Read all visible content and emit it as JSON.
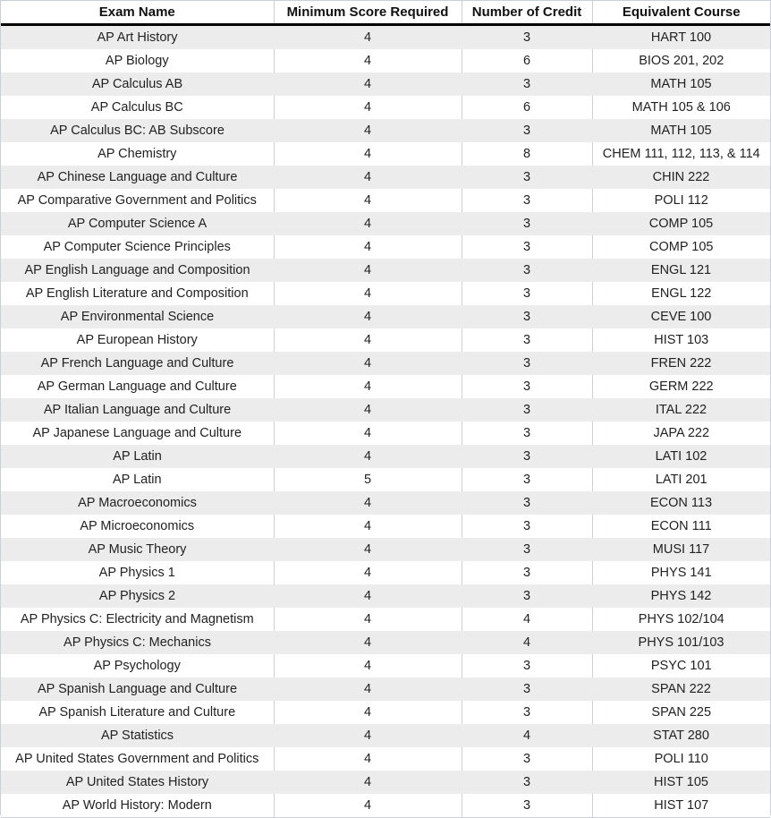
{
  "table": {
    "headers": [
      "Exam Name",
      "Minimum Score Required",
      "Number of Credit",
      "Equivalent Course"
    ],
    "rows": [
      [
        "AP Art History",
        "4",
        "3",
        "HART 100"
      ],
      [
        "AP Biology",
        "4",
        "6",
        "BIOS 201, 202"
      ],
      [
        "AP Calculus AB",
        "4",
        "3",
        "MATH 105"
      ],
      [
        "AP Calculus BC",
        "4",
        "6",
        "MATH 105 & 106"
      ],
      [
        "AP Calculus BC: AB Subscore",
        "4",
        "3",
        "MATH 105"
      ],
      [
        "AP Chemistry",
        "4",
        "8",
        "CHEM 111, 112, 113, & 114"
      ],
      [
        "AP Chinese Language and Culture",
        "4",
        "3",
        "CHIN 222"
      ],
      [
        "AP Comparative Government and Politics",
        "4",
        "3",
        "POLI 112"
      ],
      [
        "AP Computer Science A",
        "4",
        "3",
        "COMP 105"
      ],
      [
        "AP Computer Science Principles",
        "4",
        "3",
        "COMP 105"
      ],
      [
        "AP English Language and Composition",
        "4",
        "3",
        "ENGL 121"
      ],
      [
        "AP English Literature and Composition",
        "4",
        "3",
        "ENGL 122"
      ],
      [
        "AP Environmental Science",
        "4",
        "3",
        "CEVE 100"
      ],
      [
        "AP European History",
        "4",
        "3",
        "HIST 103"
      ],
      [
        "AP French Language and Culture",
        "4",
        "3",
        "FREN 222"
      ],
      [
        "AP German Language and Culture",
        "4",
        "3",
        "GERM 222"
      ],
      [
        "AP Italian Language and Culture",
        "4",
        "3",
        "ITAL 222"
      ],
      [
        "AP Japanese Language and Culture",
        "4",
        "3",
        "JAPA 222"
      ],
      [
        "AP Latin",
        "4",
        "3",
        "LATI 102"
      ],
      [
        "AP Latin",
        "5",
        "3",
        "LATI 201"
      ],
      [
        "AP Macroeconomics",
        "4",
        "3",
        "ECON 113"
      ],
      [
        "AP Microeconomics",
        "4",
        "3",
        "ECON 111"
      ],
      [
        "AP Music Theory",
        "4",
        "3",
        "MUSI 117"
      ],
      [
        "AP Physics 1",
        "4",
        "3",
        "PHYS 141"
      ],
      [
        "AP Physics 2",
        "4",
        "3",
        "PHYS 142"
      ],
      [
        "AP Physics C: Electricity and Magnetism",
        "4",
        "4",
        "PHYS 102/104"
      ],
      [
        "AP Physics C: Mechanics",
        "4",
        "4",
        "PHYS 101/103"
      ],
      [
        "AP Psychology",
        "4",
        "3",
        "PSYC 101"
      ],
      [
        "AP Spanish Language and Culture",
        "4",
        "3",
        "SPAN 222"
      ],
      [
        "AP Spanish Literature and Culture",
        "4",
        "3",
        "SPAN 225"
      ],
      [
        "AP Statistics",
        "4",
        "4",
        "STAT 280"
      ],
      [
        "AP United States Government and Politics",
        "4",
        "3",
        "POLI 110"
      ],
      [
        "AP United States History",
        "4",
        "3",
        "HIST 105"
      ],
      [
        "AP World History: Modern",
        "4",
        "3",
        "HIST 107"
      ]
    ]
  }
}
